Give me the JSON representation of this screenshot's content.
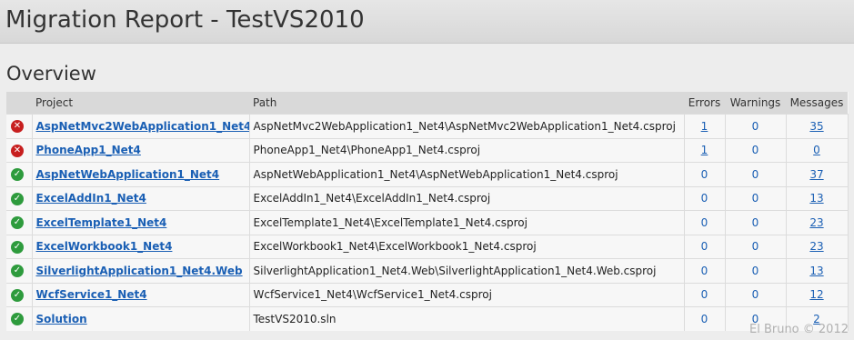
{
  "header": {
    "title": "Migration Report - TestVS2010"
  },
  "overview": {
    "title": "Overview",
    "columns": {
      "project": "Project",
      "path": "Path",
      "errors": "Errors",
      "warnings": "Warnings",
      "messages": "Messages"
    },
    "rows": [
      {
        "status": "error",
        "project": "AspNetMvc2WebApplication1_Net4",
        "path": "AspNetMvc2WebApplication1_Net4\\AspNetMvc2WebApplication1_Net4.csproj",
        "errors": "1",
        "warnings": "0",
        "messages": "35"
      },
      {
        "status": "error",
        "project": "PhoneApp1_Net4",
        "path": "PhoneApp1_Net4\\PhoneApp1_Net4.csproj",
        "errors": "1",
        "warnings": "0",
        "messages": "0"
      },
      {
        "status": "ok",
        "project": "AspNetWebApplication1_Net4",
        "path": "AspNetWebApplication1_Net4\\AspNetWebApplication1_Net4.csproj",
        "errors": "0",
        "warnings": "0",
        "messages": "37"
      },
      {
        "status": "ok",
        "project": "ExcelAddIn1_Net4",
        "path": "ExcelAddIn1_Net4\\ExcelAddIn1_Net4.csproj",
        "errors": "0",
        "warnings": "0",
        "messages": "13"
      },
      {
        "status": "ok",
        "project": "ExcelTemplate1_Net4",
        "path": "ExcelTemplate1_Net4\\ExcelTemplate1_Net4.csproj",
        "errors": "0",
        "warnings": "0",
        "messages": "23"
      },
      {
        "status": "ok",
        "project": "ExcelWorkbook1_Net4",
        "path": "ExcelWorkbook1_Net4\\ExcelWorkbook1_Net4.csproj",
        "errors": "0",
        "warnings": "0",
        "messages": "23"
      },
      {
        "status": "ok",
        "project": "SilverlightApplication1_Net4.Web",
        "path": "SilverlightApplication1_Net4.Web\\SilverlightApplication1_Net4.Web.csproj",
        "errors": "0",
        "warnings": "0",
        "messages": "13"
      },
      {
        "status": "ok",
        "project": "WcfService1_Net4",
        "path": "WcfService1_Net4\\WcfService1_Net4.csproj",
        "errors": "0",
        "warnings": "0",
        "messages": "12"
      },
      {
        "status": "ok",
        "project": "Solution",
        "path": "TestVS2010.sln",
        "errors": "0",
        "warnings": "0",
        "messages": "2"
      }
    ]
  },
  "icons": {
    "ok": "check-circle-icon",
    "error": "error-circle-icon"
  },
  "colors": {
    "ok": "#2e9b3d",
    "error": "#c71f1f",
    "link": "#1a5fb4"
  },
  "watermark": "El Bruno © 2012"
}
